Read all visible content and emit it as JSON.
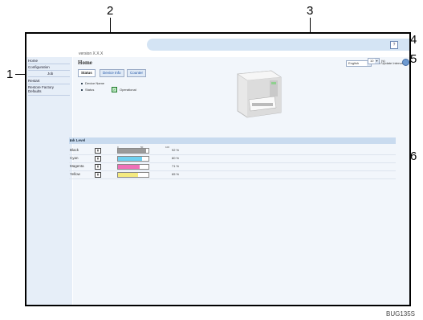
{
  "callouts": [
    "1",
    "2",
    "3",
    "4",
    "5",
    "6"
  ],
  "version": "version X.X.X",
  "top_button": "?",
  "sidebar": {
    "items": [
      "Home",
      "Configuration",
      "Job",
      "Restart",
      "Restore Factory",
      "Defaults"
    ]
  },
  "main": {
    "title": "Home",
    "language": "English",
    "auto_update_label": "Auto Update Interval",
    "auto_update_value": "10",
    "auto_update_unit": "(s)",
    "tabs": [
      "Status",
      "Device Info",
      "Counter"
    ],
    "device_name_label": "Device Name",
    "status_label": "Status",
    "status_value": "Operational"
  },
  "ink": {
    "header": "Ink Level",
    "scale": [
      "0",
      "50",
      "100"
    ],
    "rows": [
      {
        "name": "Black",
        "percent": 92,
        "label": "92 %",
        "color": "#9a9a9a"
      },
      {
        "name": "Cyan",
        "percent": 80,
        "label": "80 %",
        "color": "#6fd0f0"
      },
      {
        "name": "Magenta",
        "percent": 71,
        "label": "71 %",
        "color": "#f070b8"
      },
      {
        "name": "Yellow",
        "percent": 65,
        "label": "65 %",
        "color": "#f4ea80"
      }
    ]
  },
  "caption": "BUG135S"
}
